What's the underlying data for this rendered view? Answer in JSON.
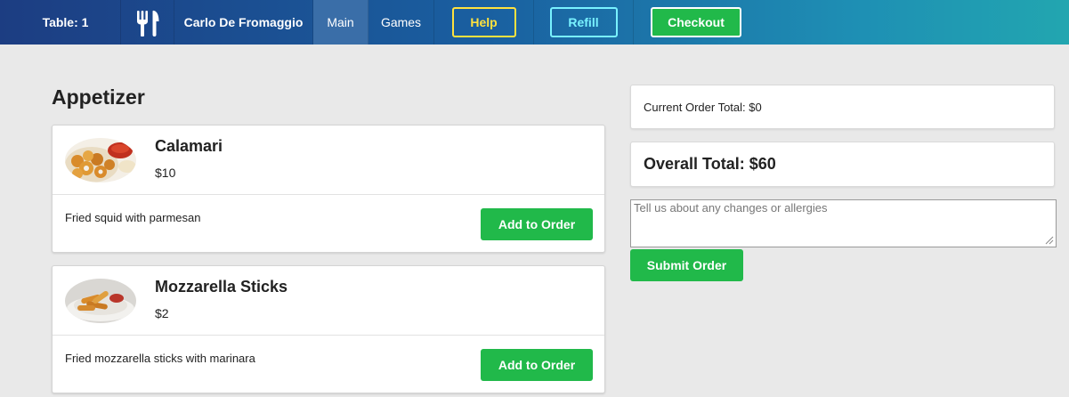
{
  "nav": {
    "table_label": "Table: 1",
    "logo_icon": "fork-knife-icon",
    "user_name": "Carlo De Fromaggio",
    "main_tab": "Main",
    "games_tab": "Games",
    "help_label": "Help",
    "refill_label": "Refill",
    "checkout_label": "Checkout",
    "colors": {
      "help": "#ffe23f",
      "refill": "#79f2ff",
      "checkout": "#21b94a"
    }
  },
  "section": {
    "title": "Appetizer"
  },
  "items": [
    {
      "name": "Calamari",
      "price": "$10",
      "description": "Fried squid with parmesan",
      "button_label": "Add to Order",
      "image_icon": "calamari-photo"
    },
    {
      "name": "Mozzarella Sticks",
      "price": "$2",
      "description": "Fried mozzarella sticks with marinara",
      "button_label": "Add to Order",
      "image_icon": "mozzarella-sticks-photo"
    }
  ],
  "order": {
    "current_total": "Current Order Total: $0",
    "overall_total": "Overall Total: $60",
    "notes_placeholder": "Tell us about any changes or allergies",
    "notes_value": "",
    "submit_label": "Submit Order"
  },
  "accent_color": "#21b94a"
}
